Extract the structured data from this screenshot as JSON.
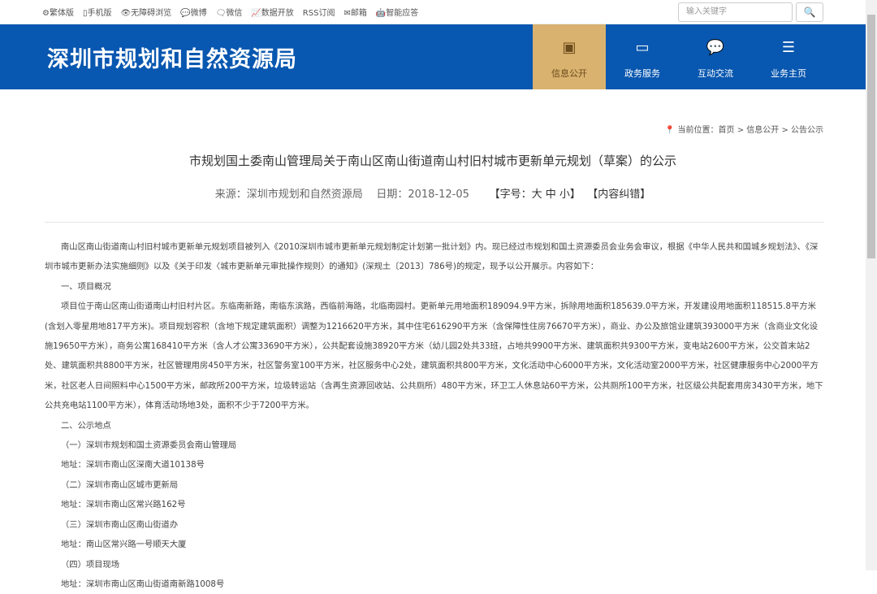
{
  "topbar": {
    "links": [
      "⚙繁体版",
      "▯手机版",
      "👁无障碍浏览",
      "💬微博",
      "🗨微信",
      "📈数据开放",
      "RSS订阅",
      "✉邮箱",
      "🤖智能应答"
    ],
    "search_placeholder": "输入关键字",
    "search_icon": "🔍"
  },
  "header": {
    "logo": "深圳市规划和自然资源局",
    "nav": [
      {
        "icon": "▣",
        "label": "信息公开"
      },
      {
        "icon": "▭",
        "label": "政务服务"
      },
      {
        "icon": "💬",
        "label": "互动交流"
      },
      {
        "icon": "☰",
        "label": "业务主页"
      }
    ]
  },
  "breadcrumb": "当前位置：首页 > 信息公开 > 公告公示",
  "article": {
    "title": "市规划国土委南山管理局关于南山区南山街道南山村旧村城市更新单元规划（草案）的公示",
    "source": "来源：深圳市规划和自然资源局",
    "date": "日期：2018-12-05",
    "fontsize": "【字号：大 中 小】",
    "correction": "【内容纠错】",
    "paragraphs": [
      "南山区南山街道南山村旧村城市更新单元规划项目被列入《2010深圳市城市更新单元规划制定计划第一批计划》内。现已经过市规划和国土资源委员会业务会审议，根据《中华人民共和国城乡规划法》、《深圳市城市更新办法实施细则》以及《关于印发〈城市更新单元审批操作规则〉的通知》(深规土〔2013〕786号)的规定，现予以公开展示。内容如下：",
      "一、项目概况",
      "项目位于南山区南山街道南山村旧村片区。东临南新路，南临东滨路，西临前海路，北临南园村。更新单元用地面积189094.9平方米，拆除用地面积185639.0平方米，开发建设用地面积118515.8平方米(含划入零星用地817平方米)。项目规划容积（含地下规定建筑面积）调整为1216620平方米，其中住宅616290平方米（含保障性住房76670平方米），商业、办公及旅馆业建筑393000平方米（含商业文化设施19650平方米），商务公寓168410平方米（含人才公寓33690平方米），公共配套设施38920平方米（幼儿园2处共33班，占地共9900平方米、建筑面积共9300平方米，变电站2600平方米，公交首末站2处、建筑面积共8800平方米，社区管理用房450平方米，社区警务室100平方米，社区服务中心2处，建筑面积共800平方米，文化活动中心6000平方米，文化活动室2000平方米，社区健康服务中心2000平方米，社区老人日间照料中心1500平方米，邮政所200平方米，垃圾转运站（含再生资源回收站、公共厕所）480平方米，环卫工人休息站60平方米，公共厕所100平方米，社区级公共配套用房3430平方米，地下公共充电站1100平方米），体育活动场地3处，面积不少于7200平方米。",
      "二、公示地点",
      "（一）深圳市规划和国土资源委员会南山管理局",
      "地址：深圳市南山区深南大道10138号",
      "（二）深圳市南山区城市更新局",
      "地址：深圳市南山区常兴路162号",
      "（三）深圳市南山区南山街道办",
      "地址：南山区常兴路一号顺天大厦",
      "（四）项目现场",
      "地址：深圳市南山区南山街道南新路1008号"
    ]
  }
}
